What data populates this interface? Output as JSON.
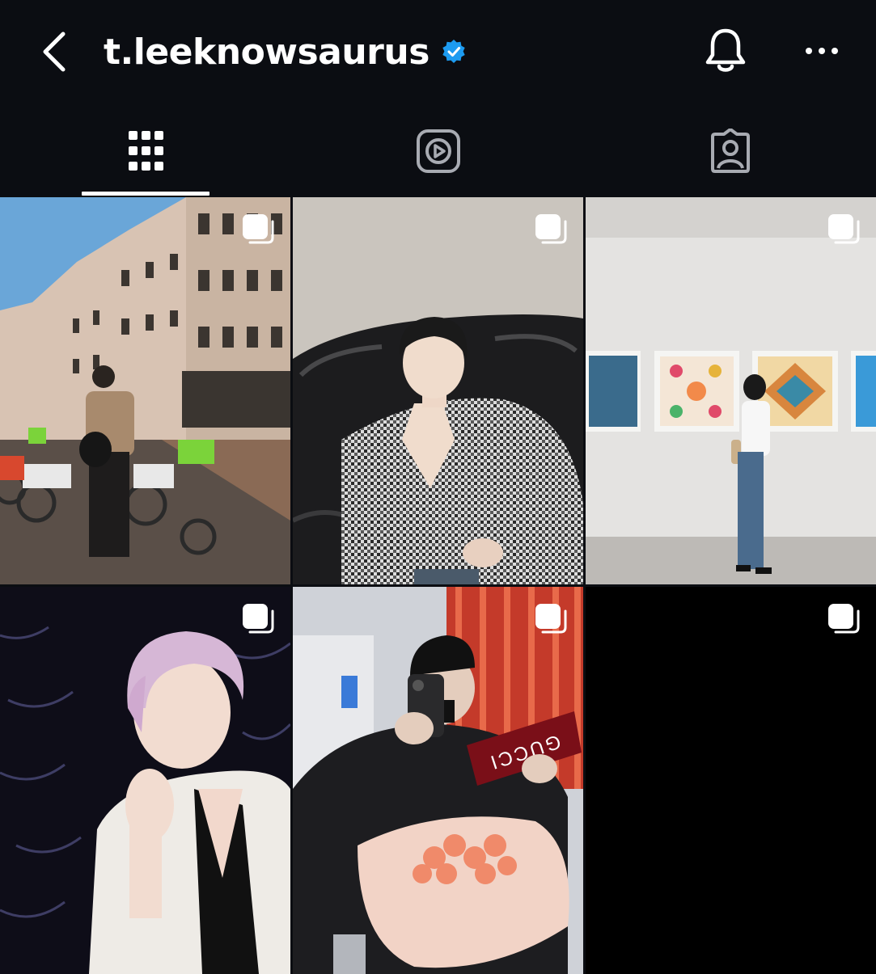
{
  "header": {
    "username": "t.leeknowsaurus",
    "verified": true,
    "back_icon": "chevron-left-icon",
    "bell_icon": "bell-icon",
    "more_icon": "more-horizontal-icon"
  },
  "tabs": [
    {
      "icon": "grid-icon",
      "active": true
    },
    {
      "icon": "reels-icon",
      "active": false
    },
    {
      "icon": "tagged-icon",
      "active": false
    }
  ],
  "posts": [
    {
      "type": "carousel",
      "icon": "multiple-photos-icon"
    },
    {
      "type": "carousel",
      "icon": "multiple-photos-icon"
    },
    {
      "type": "carousel",
      "icon": "multiple-photos-icon"
    },
    {
      "type": "carousel",
      "icon": "multiple-photos-icon"
    },
    {
      "type": "carousel",
      "icon": "multiple-photos-icon",
      "card_text": "GUCCI"
    },
    {
      "type": "carousel",
      "icon": "multiple-photos-icon"
    }
  ],
  "colors": {
    "background": "#0b0d12",
    "text": "#ffffff",
    "verified_blue": "#1d9bf0",
    "inactive_icon": "#a8abb2"
  }
}
